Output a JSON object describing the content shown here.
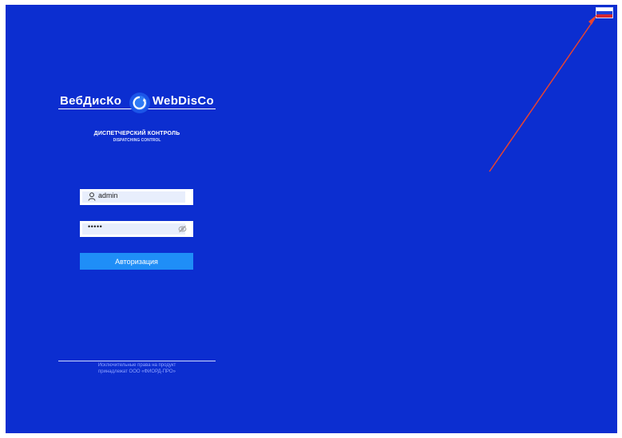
{
  "colors": {
    "background": "#0c2ed0",
    "button": "#1f8ef7",
    "arrow": "#e8432f",
    "flag": [
      "#ffffff",
      "#1c3fd8",
      "#d7262e"
    ]
  },
  "header": {
    "language_flag": "russian-flag-icon"
  },
  "logo": {
    "left_text": "ВебДисКо",
    "right_text": "WebDisCo",
    "icon": "gear-icon",
    "subtitle_ru": "ДИСПЕТЧЕРСКИЙ КОНТРОЛЬ",
    "subtitle_en": "DISPATCHING CONTROL"
  },
  "login_form": {
    "username_icon": "user-icon",
    "username_value": "admin",
    "password_value": "•••••",
    "password_toggle_icon": "eye-off-icon",
    "submit_label": "Авторизация"
  },
  "footer": {
    "line1": "Исключительные права на продукт",
    "line2": "принадлежат ООО «ФИОРД-ПРО»"
  }
}
